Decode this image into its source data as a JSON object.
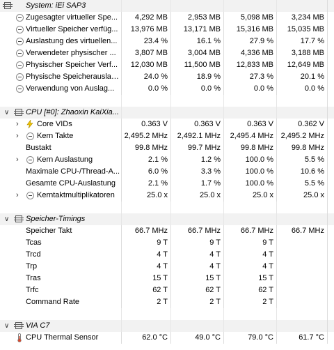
{
  "colors": {
    "group_bg": "#f2f2f2",
    "grid": "#dcdcdc",
    "bolt": "#f0c400",
    "therm": "#d94a2e"
  },
  "groups": {
    "system": {
      "title": "System: iEi SAP3"
    },
    "cpu": {
      "title": "CPU [#0]: Zhaoxin KaiXia..."
    },
    "timings": {
      "title": "Speicher-Timings"
    },
    "via": {
      "title": "VIA C7"
    }
  },
  "rows": {
    "sys_commit": {
      "label": "Zugesagter virtueller Spe...",
      "v": [
        "4,292 MB",
        "2,953 MB",
        "5,098 MB",
        "3,234 MB"
      ]
    },
    "sys_vavail": {
      "label": "Virtueller Speicher verfüg...",
      "v": [
        "13,976 MB",
        "13,171 MB",
        "15,316 MB",
        "15,035 MB"
      ]
    },
    "sys_vload": {
      "label": "Auslastung des virtuellen...",
      "v": [
        "23.4 %",
        "16.1 %",
        "27.9 %",
        "17.7 %"
      ]
    },
    "sys_pused": {
      "label": "Verwendeter physischer ...",
      "v": [
        "3,807 MB",
        "3,004 MB",
        "4,336 MB",
        "3,188 MB"
      ]
    },
    "sys_pavail": {
      "label": "Physischer Speicher Verf...",
      "v": [
        "12,030 MB",
        "11,500 MB",
        "12,833 MB",
        "12,649 MB"
      ]
    },
    "sys_pload": {
      "label": "Physische Speicherauslas...",
      "v": [
        "24.0 %",
        "18.9 %",
        "27.3 %",
        "20.1 %"
      ]
    },
    "sys_swap": {
      "label": "Verwendung von Auslag...",
      "v": [
        "0.0 %",
        "0.0 %",
        "0.0 %",
        "0.0 %"
      ]
    },
    "cpu_vid": {
      "label": "Core VIDs",
      "v": [
        "0.363 V",
        "0.363 V",
        "0.363 V",
        "0.362 V"
      ]
    },
    "cpu_clk": {
      "label": "Kern Takte",
      "v": [
        "2,495.2 MHz",
        "2,492.1 MHz",
        "2,495.4 MHz",
        "2,495.2 MHz"
      ]
    },
    "cpu_bus": {
      "label": "Bustakt",
      "v": [
        "99.8 MHz",
        "99.7 MHz",
        "99.8 MHz",
        "99.8 MHz"
      ]
    },
    "cpu_kload": {
      "label": "Kern Auslastung",
      "v": [
        "2.1 %",
        "1.2 %",
        "100.0 %",
        "5.5 %"
      ]
    },
    "cpu_max": {
      "label": "Maximale CPU-/Thread-A...",
      "v": [
        "6.0 %",
        "3.3 %",
        "100.0 %",
        "10.6 %"
      ]
    },
    "cpu_total": {
      "label": "Gesamte CPU-Auslastung",
      "v": [
        "2.1 %",
        "1.7 %",
        "100.0 %",
        "5.5 %"
      ]
    },
    "cpu_mult": {
      "label": "Kerntaktmultiplikatoren",
      "v": [
        "25.0 x",
        "25.0 x",
        "25.0 x",
        "25.0 x"
      ]
    },
    "t_clk": {
      "label": "Speicher Takt",
      "v": [
        "66.7 MHz",
        "66.7 MHz",
        "66.7 MHz",
        "66.7 MHz"
      ]
    },
    "t_tcas": {
      "label": "Tcas",
      "v": [
        "9 T",
        "9 T",
        "9 T",
        ""
      ]
    },
    "t_trcd": {
      "label": "Trcd",
      "v": [
        "4 T",
        "4 T",
        "4 T",
        ""
      ]
    },
    "t_trp": {
      "label": "Trp",
      "v": [
        "4 T",
        "4 T",
        "4 T",
        ""
      ]
    },
    "t_tras": {
      "label": "Tras",
      "v": [
        "15 T",
        "15 T",
        "15 T",
        ""
      ]
    },
    "t_trfc": {
      "label": "Trfc",
      "v": [
        "62 T",
        "62 T",
        "62 T",
        ""
      ]
    },
    "t_cr": {
      "label": "Command Rate",
      "v": [
        "2 T",
        "2 T",
        "2 T",
        ""
      ]
    },
    "via_therm": {
      "label": "CPU Thermal Sensor",
      "v": [
        "62.0 °C",
        "49.0 °C",
        "79.0 °C",
        "61.7 °C"
      ]
    }
  }
}
